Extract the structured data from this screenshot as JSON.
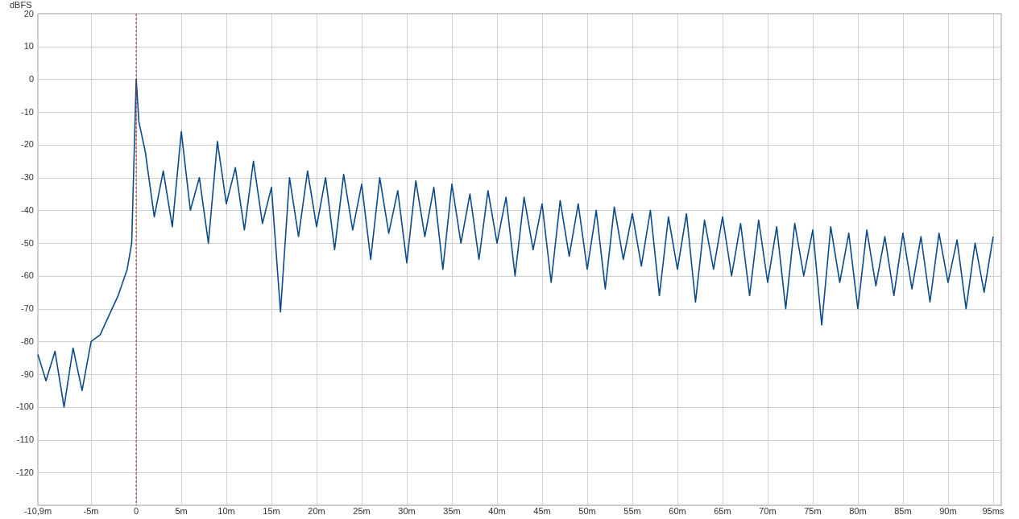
{
  "chart": {
    "chart_data": {
      "type": "line",
      "ylabel": "dBFS",
      "grid": true,
      "ref_lines": [
        {
          "axis": "x",
          "value": 0,
          "color": "#b3262b"
        }
      ],
      "xlim": [
        -10.9,
        95.9
      ],
      "ylim": [
        -130,
        20
      ],
      "yticks": [
        {
          "value": 20,
          "label": "20"
        },
        {
          "value": 10,
          "label": "10"
        },
        {
          "value": 0,
          "label": "0"
        },
        {
          "value": -10,
          "label": "-10"
        },
        {
          "value": -20,
          "label": "-20"
        },
        {
          "value": -30,
          "label": "-30"
        },
        {
          "value": -40,
          "label": "-40"
        },
        {
          "value": -50,
          "label": "-50"
        },
        {
          "value": -60,
          "label": "-60"
        },
        {
          "value": -70,
          "label": "-70"
        },
        {
          "value": -80,
          "label": "-80"
        },
        {
          "value": -90,
          "label": "-90"
        },
        {
          "value": -100,
          "label": "-100"
        },
        {
          "value": -110,
          "label": "-110"
        },
        {
          "value": -120,
          "label": "-120"
        }
      ],
      "xticks": [
        {
          "value": -10.9,
          "label": "-10,9m"
        },
        {
          "value": -5,
          "label": "-5m"
        },
        {
          "value": 0,
          "label": "0"
        },
        {
          "value": 5,
          "label": "5m"
        },
        {
          "value": 10,
          "label": "10m"
        },
        {
          "value": 15,
          "label": "15m"
        },
        {
          "value": 20,
          "label": "20m"
        },
        {
          "value": 25,
          "label": "25m"
        },
        {
          "value": 30,
          "label": "30m"
        },
        {
          "value": 35,
          "label": "35m"
        },
        {
          "value": 40,
          "label": "40m"
        },
        {
          "value": 45,
          "label": "45m"
        },
        {
          "value": 50,
          "label": "50m"
        },
        {
          "value": 55,
          "label": "55m"
        },
        {
          "value": 60,
          "label": "60m"
        },
        {
          "value": 65,
          "label": "65m"
        },
        {
          "value": 70,
          "label": "70m"
        },
        {
          "value": 75,
          "label": "75m"
        },
        {
          "value": 80,
          "label": "80m"
        },
        {
          "value": 85,
          "label": "85m"
        },
        {
          "value": 90,
          "label": "90m"
        },
        {
          "value": 95,
          "label": "95ms"
        }
      ],
      "x": [
        -10.9,
        -10,
        -9,
        -8,
        -7,
        -6,
        -5,
        -4,
        -3,
        -2,
        -1,
        -0.5,
        0,
        0.3,
        1,
        2,
        3,
        4,
        5,
        6,
        7,
        8,
        9,
        10,
        11,
        12,
        13,
        14,
        15,
        16,
        17,
        18,
        19,
        20,
        21,
        22,
        23,
        24,
        25,
        26,
        27,
        28,
        29,
        30,
        31,
        32,
        33,
        34,
        35,
        36,
        37,
        38,
        39,
        40,
        41,
        42,
        43,
        44,
        45,
        46,
        47,
        48,
        49,
        50,
        51,
        52,
        53,
        54,
        55,
        56,
        57,
        58,
        59,
        60,
        61,
        62,
        63,
        64,
        65,
        66,
        67,
        68,
        69,
        70,
        71,
        72,
        73,
        74,
        75,
        76,
        77,
        78,
        79,
        80,
        81,
        82,
        83,
        84,
        85,
        86,
        87,
        88,
        89,
        90,
        91,
        92,
        93,
        94,
        95
      ],
      "series": [
        {
          "color": "#0b4a8b",
          "values": [
            -84,
            -92,
            -83,
            -100,
            -82,
            -95,
            -80,
            -78,
            -72,
            -66,
            -58,
            -50,
            0,
            -13,
            -22,
            -42,
            -28,
            -45,
            -16,
            -40,
            -30,
            -50,
            -19,
            -38,
            -27,
            -46,
            -25,
            -44,
            -33,
            -71,
            -30,
            -48,
            -28,
            -45,
            -30,
            -52,
            -29,
            -46,
            -32,
            -55,
            -30,
            -47,
            -34,
            -56,
            -31,
            -48,
            -33,
            -58,
            -32,
            -50,
            -35,
            -55,
            -34,
            -50,
            -36,
            -60,
            -36,
            -52,
            -38,
            -62,
            -37,
            -54,
            -38,
            -58,
            -40,
            -64,
            -39,
            -55,
            -41,
            -57,
            -40,
            -66,
            -42,
            -58,
            -41,
            -68,
            -43,
            -58,
            -42,
            -60,
            -44,
            -66,
            -43,
            -62,
            -45,
            -70,
            -44,
            -60,
            -46,
            -75,
            -45,
            -62,
            -47,
            -70,
            -46,
            -63,
            -48,
            -66,
            -47,
            -64,
            -48,
            -68,
            -47,
            -62,
            -49,
            -70,
            -50,
            -65,
            -48
          ]
        }
      ]
    }
  }
}
